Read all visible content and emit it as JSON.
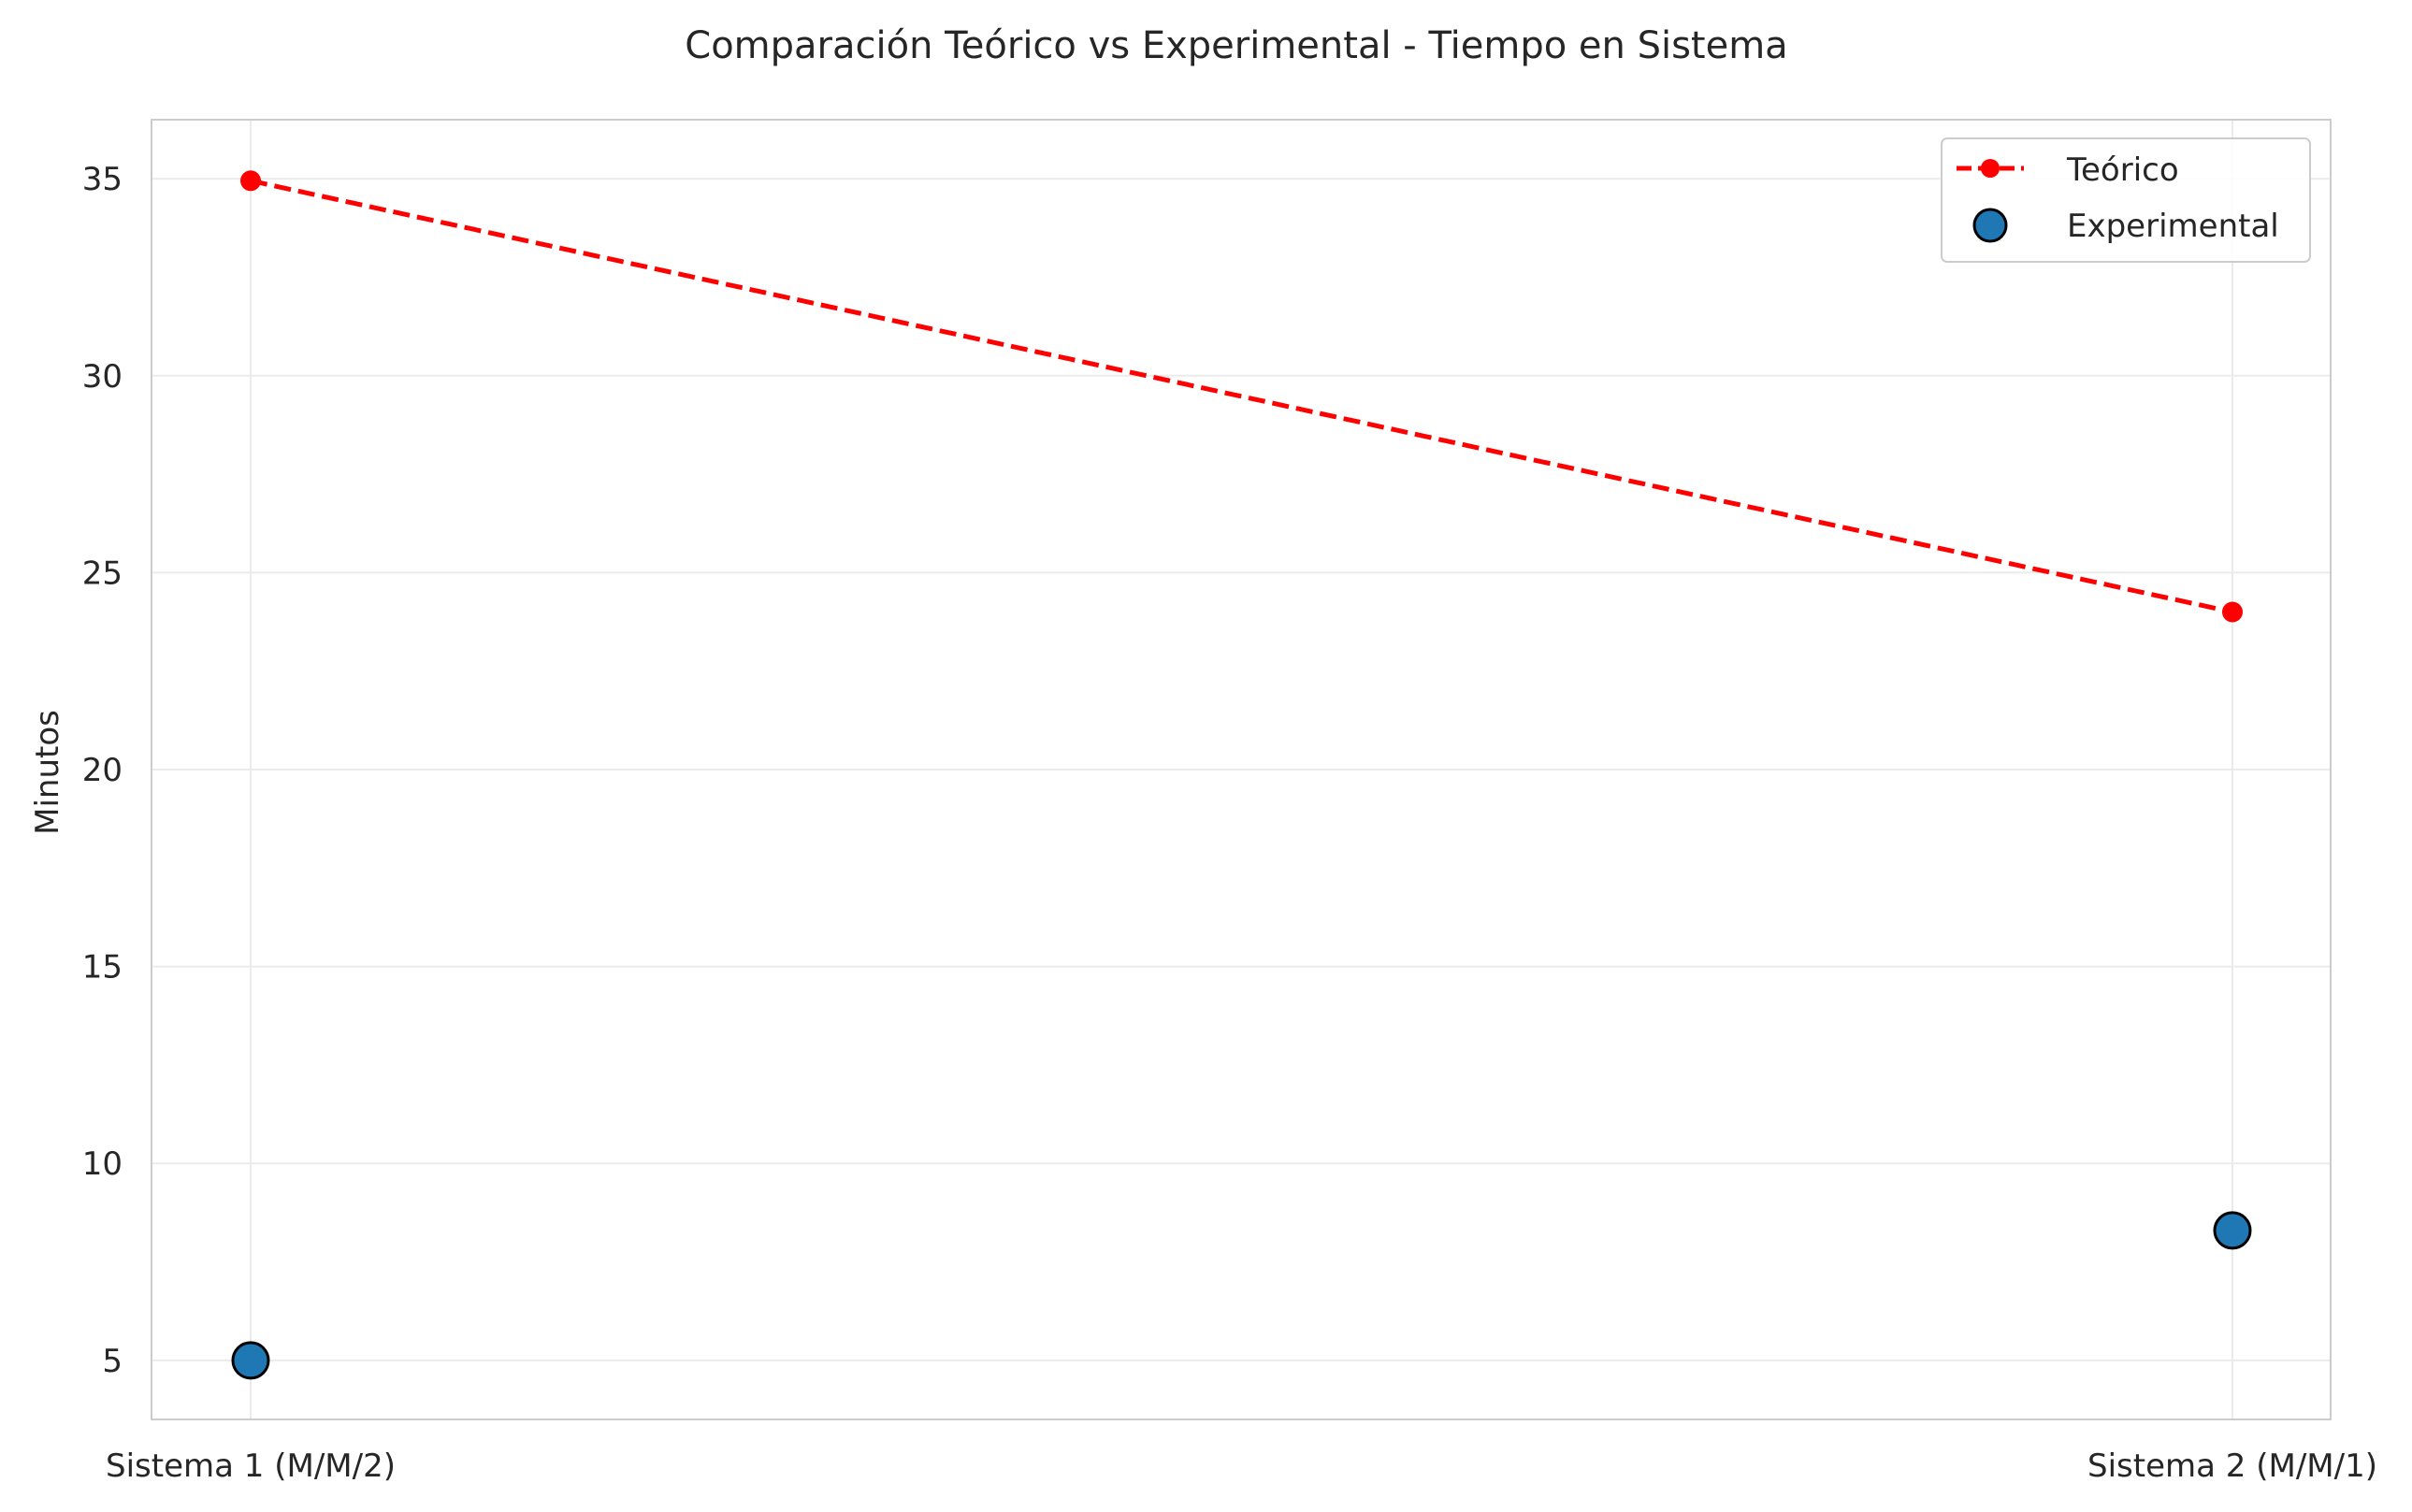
{
  "chart_data": {
    "type": "line",
    "title": "Comparación Teórico vs Experimental - Tiempo en Sistema",
    "xlabel": "",
    "ylabel": "Minutos",
    "categories": [
      "Sistema 1 (M/M/2)",
      "Sistema 2 (M/M/1)"
    ],
    "ylim": [
      3.5,
      36.5
    ],
    "yticks": [
      "5",
      "10",
      "15",
      "20",
      "25",
      "30",
      "35"
    ],
    "grid": true,
    "legend_position": "upper right",
    "series": [
      {
        "name": "Teórico",
        "kind": "line",
        "style": "dashed",
        "marker": "circle",
        "color": "#ff0000",
        "values": [
          34.95,
          24.0
        ]
      },
      {
        "name": "Experimental",
        "kind": "scatter",
        "marker": "circle",
        "color": "#1f77b4",
        "edgecolor": "#000000",
        "values": [
          5.0,
          8.3
        ]
      }
    ]
  }
}
